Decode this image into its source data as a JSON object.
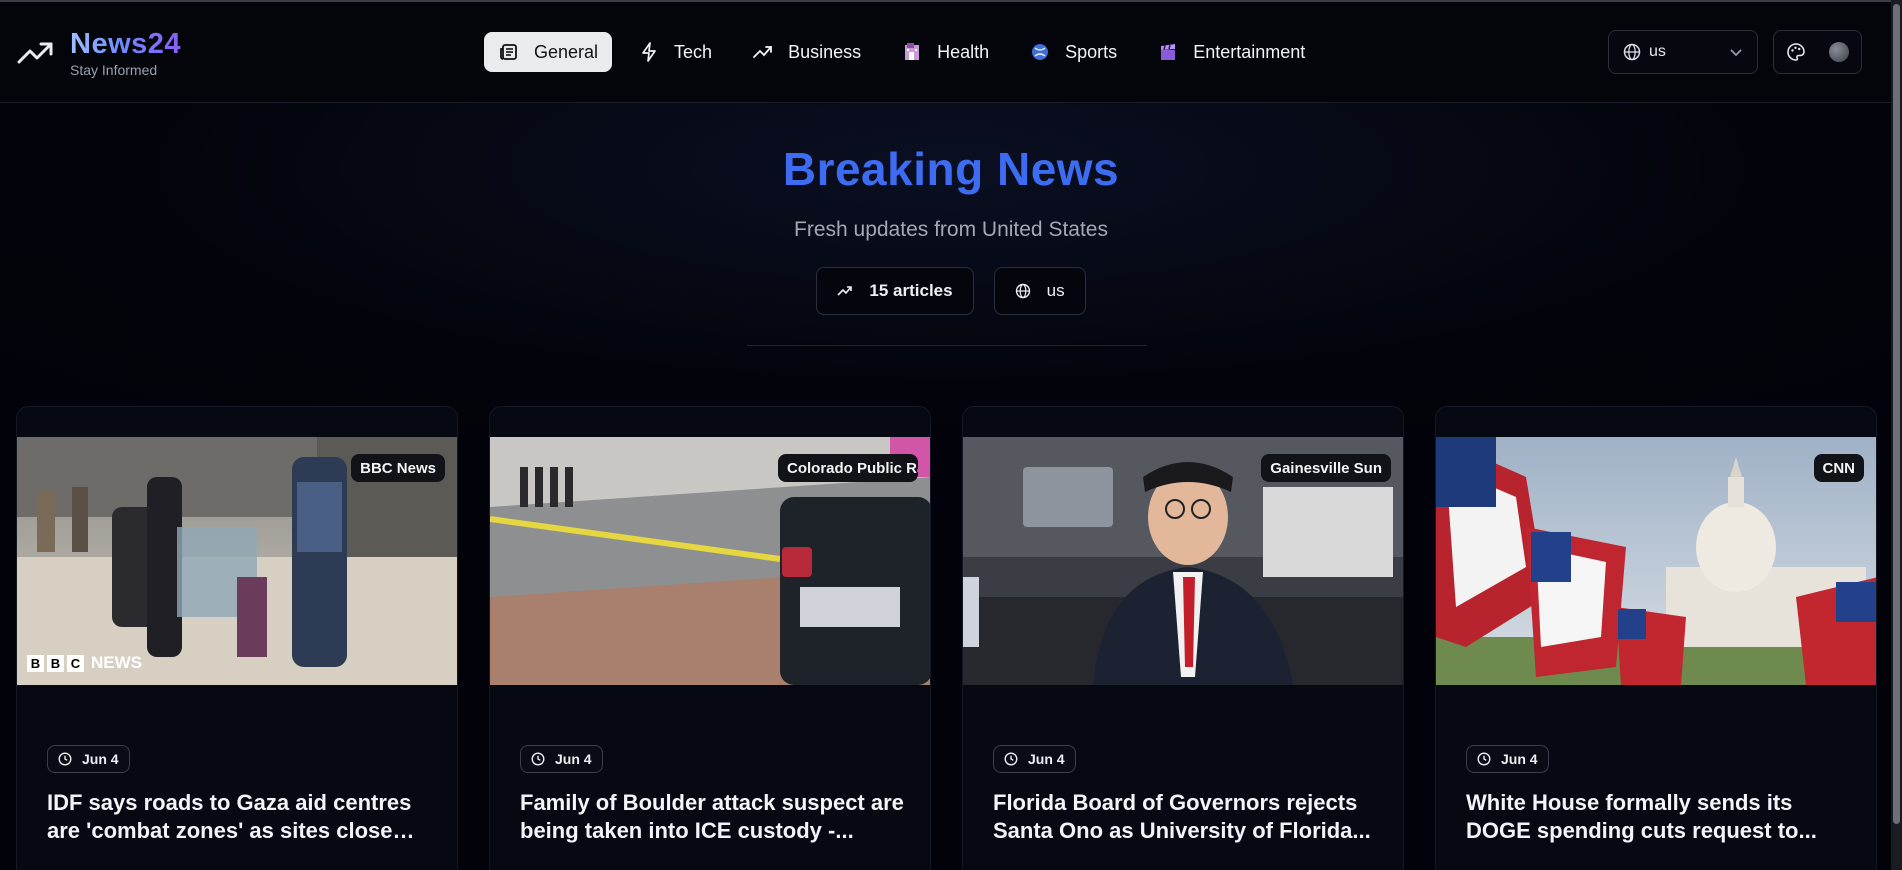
{
  "brand": {
    "name": "News24",
    "tagline": "Stay Informed"
  },
  "nav": {
    "items": [
      {
        "label": "General",
        "icon": "newspaper-icon",
        "active": true
      },
      {
        "label": "Tech",
        "icon": "lightning-icon",
        "active": false
      },
      {
        "label": "Business",
        "icon": "trending-up-icon",
        "active": false
      },
      {
        "label": "Health",
        "icon": "hospital-icon",
        "active": false
      },
      {
        "label": "Sports",
        "icon": "ball-icon",
        "active": false
      },
      {
        "label": "Entertainment",
        "icon": "clapper-icon",
        "active": false
      }
    ]
  },
  "country_select": {
    "value": "us",
    "icon": "globe-icon"
  },
  "theme_toggle": {
    "icon": "palette-icon"
  },
  "hero": {
    "title": "Breaking News",
    "subtitle": "Fresh updates from United States",
    "article_count": "15 articles",
    "country": "us"
  },
  "articles": [
    {
      "source": "BBC News",
      "date": "Jun 4",
      "title": "IDF says roads to Gaza aid centres are 'combat zones' as sites close fo..."
    },
    {
      "source": "Colorado Public Radio",
      "date": "Jun 4",
      "title": "Family of Boulder attack suspect are being taken into ICE custody -..."
    },
    {
      "source": "Gainesville Sun",
      "date": "Jun 4",
      "title": "Florida Board of Governors rejects Santa Ono as University of Florida..."
    },
    {
      "source": "CNN",
      "date": "Jun 4",
      "title": "White House formally sends its DOGE spending cuts request to..."
    }
  ],
  "colors": {
    "accent": "#3d6cf3",
    "background": "#02030a",
    "active_tab": "#e9ebef"
  }
}
